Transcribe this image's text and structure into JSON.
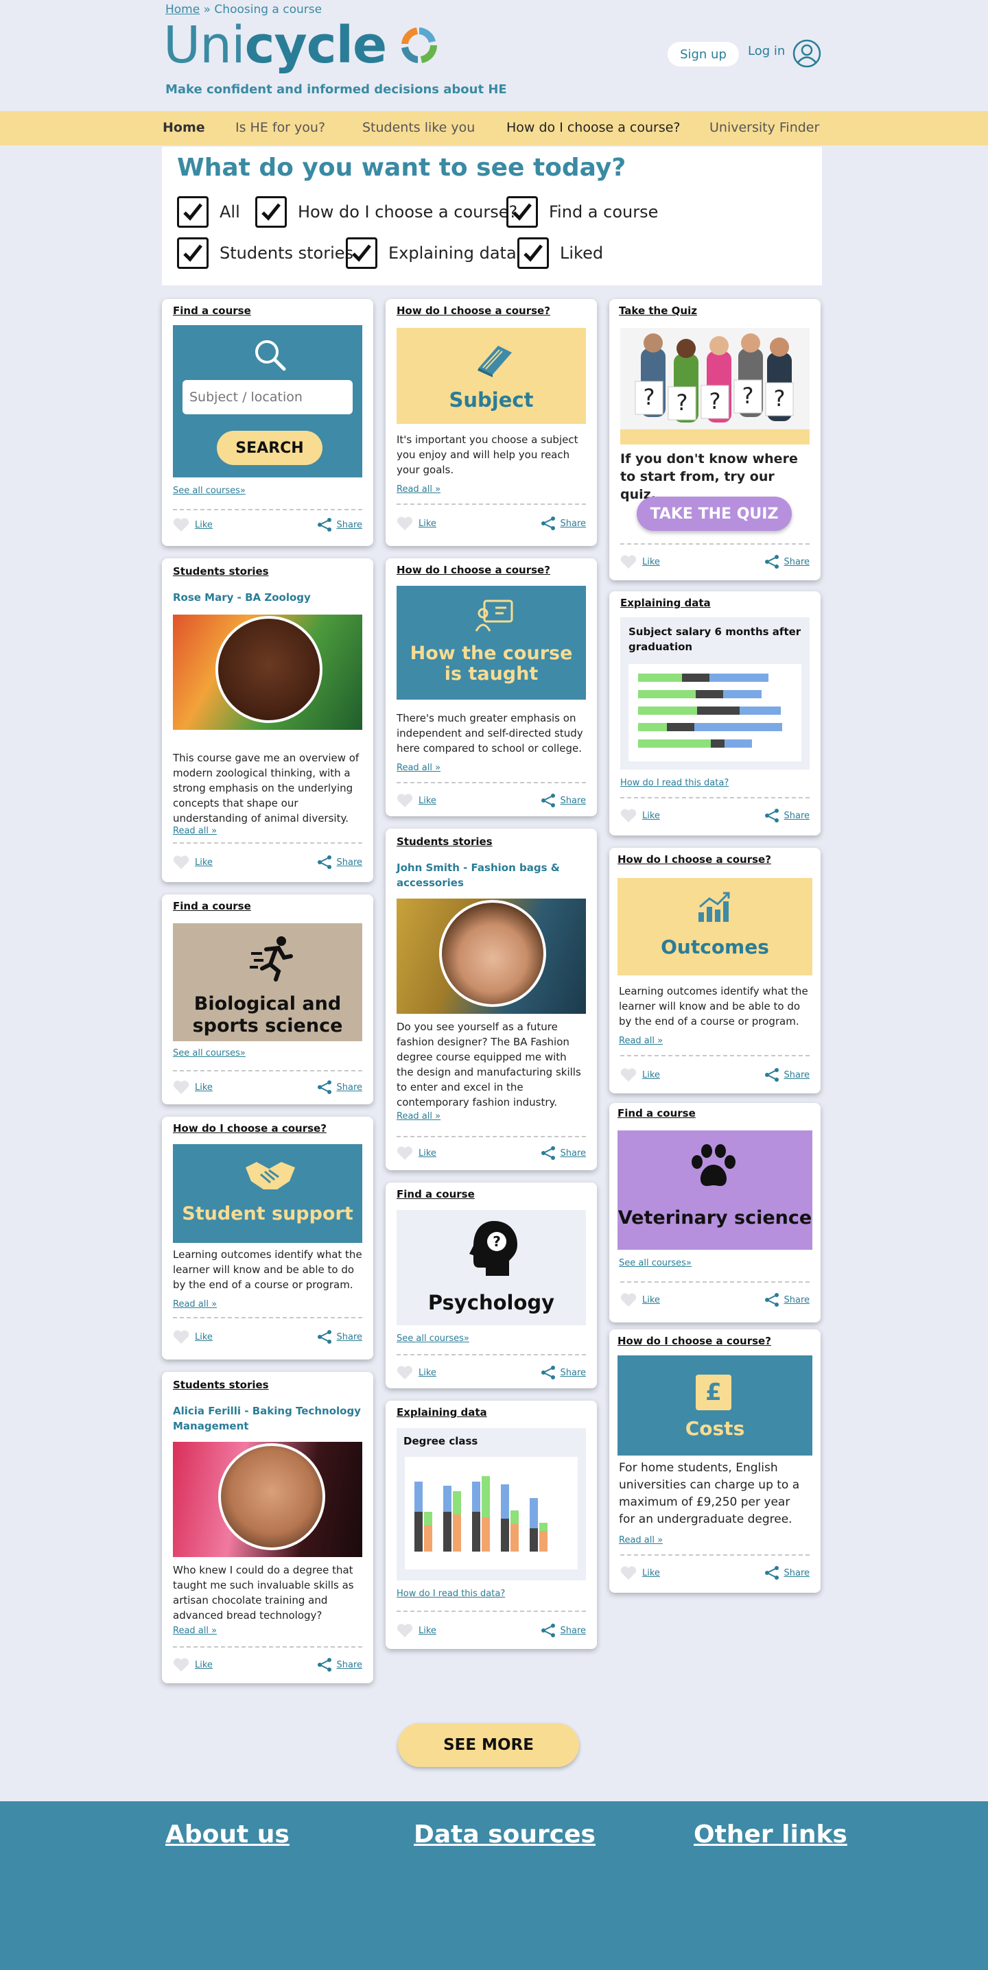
{
  "breadcrumb": {
    "home": "Home",
    "separator": "»",
    "current": "Choosing a course"
  },
  "logo": {
    "text_a": "Uni",
    "text_b": "cycle",
    "tagline": "Make confident and informed decisions about HE"
  },
  "account": {
    "signup": "Sign up",
    "login": "Log in",
    "icon": "user-icon"
  },
  "nav": [
    "Home",
    "Is HE for you?",
    "Students like you",
    "How do I choose a course?",
    "University Finder"
  ],
  "filters": {
    "title": "What do you want to see today?",
    "options": [
      "All",
      "How do I choose a course?",
      "Find a course",
      "Students stories",
      "Explaining data",
      "Liked"
    ]
  },
  "common": {
    "like": "Like",
    "share": "Share",
    "read_all": "Read all »",
    "see_all_courses": "See all courses»",
    "how_read_data": "How do I read this data?"
  },
  "cards": {
    "search": {
      "category": "Find a course",
      "placeholder": "Subject / location",
      "button": "SEARCH"
    },
    "rose": {
      "category": "Students stories",
      "name": "Rose Mary - BA Zoology",
      "text": "This course gave me an overview of modern zoological thinking, with a strong emphasis on the underlying concepts that shape our understanding of animal diversity."
    },
    "bio": {
      "category": "Find a course",
      "title": "Biological and sports science"
    },
    "support": {
      "category": "How do I choose a course?",
      "title": "Student support",
      "text": "Learning outcomes identify what the learner will know and be able to do by the end of a course or program."
    },
    "alicia": {
      "category": "Students stories",
      "name": "Alicia Ferilli - Baking Technology Management",
      "text": "Who knew I could do a degree that taught me such invaluable skills as artisan chocolate training and advanced bread technology?"
    },
    "subject": {
      "category": "How do I choose a course?",
      "title": "Subject",
      "text": "It's important you choose a subject you enjoy and will help you reach your goals."
    },
    "taught": {
      "category": "How do I choose a course?",
      "title": "How the course is taught",
      "text": "There's much greater emphasis on independent and self-directed study here compared to school or college."
    },
    "john": {
      "category": "Students stories",
      "name": "John Smith - Fashion bags & accessories",
      "text": "Do you see yourself as a future fashion designer? The BA Fashion degree course equipped me with the design and manufacturing skills to enter and excel in the contemporary fashion industry."
    },
    "psych": {
      "category": "Find a course",
      "title": "Psychology"
    },
    "degree": {
      "category": "Explaining data",
      "title": "Degree class"
    },
    "quiz": {
      "category": "Take the Quiz",
      "text": "If you don't know where to start from, try our quiz.",
      "button": "TAKE THE QUIZ"
    },
    "salary": {
      "category": "Explaining data",
      "title": "Subject salary 6 months after graduation"
    },
    "outcomes": {
      "category": "How do I choose a course?",
      "title": "Outcomes",
      "text": "Learning outcomes identify what the learner will know and be able to do by the end of a course or program."
    },
    "vet": {
      "category": "Find a course",
      "title": "Veterinary science"
    },
    "costs": {
      "category": "How do I choose a course?",
      "title": "Costs",
      "icon_glyph": "£",
      "text": "For home students, English universities can charge up to a maximum of £9,250 per year for an undergraduate degree."
    }
  },
  "see_more": "SEE MORE",
  "footer": [
    "About us",
    "Data sources",
    "Other links"
  ]
}
